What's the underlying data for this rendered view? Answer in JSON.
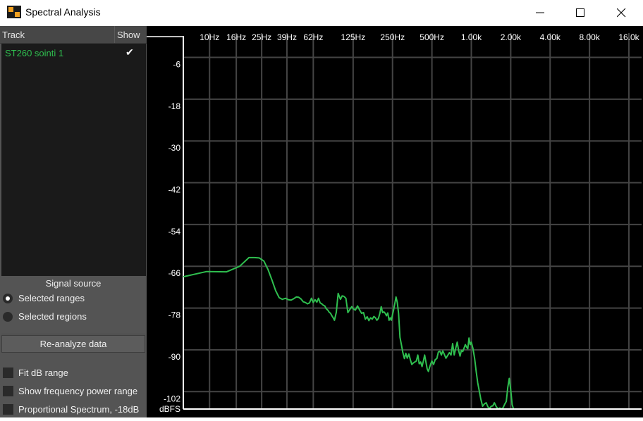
{
  "window": {
    "title": "Spectral Analysis",
    "icon": "spectral-app-icon",
    "buttons": [
      "minimize-icon",
      "maximize-icon",
      "close-icon"
    ]
  },
  "sidebar": {
    "track_header": "Track",
    "show_header": "Show",
    "tracks": [
      {
        "name": "ST260 sointi 1",
        "shown": true,
        "color": "#2fbf4f"
      }
    ],
    "signal_source": {
      "label": "Signal source",
      "options": [
        {
          "label": "Selected ranges",
          "selected": true
        },
        {
          "label": "Selected regions",
          "selected": false
        }
      ]
    },
    "reanalyze_label": "Re-analyze data",
    "checkboxes": [
      {
        "label": "Fit dB range",
        "checked": false
      },
      {
        "label": "Show frequency power range",
        "checked": false
      },
      {
        "label": "Proportional Spectrum, -18dB",
        "checked": false
      }
    ]
  },
  "plot": {
    "background": "#000000",
    "grid_color": "#444444",
    "axis_color": "#ffffff",
    "freq_labels": [
      "10Hz",
      "16Hz",
      "25Hz",
      "39Hz",
      "62Hz",
      "125Hz",
      "250Hz",
      "500Hz",
      "1.00k",
      "2.00k",
      "4.00k",
      "8.00k",
      "16.0k"
    ],
    "db_labels": [
      "-6",
      "-18",
      "-30",
      "-42",
      "-54",
      "-66",
      "-78",
      "-90",
      "-102"
    ],
    "db_unit": "dBFS"
  },
  "chart_data": {
    "type": "line",
    "title": "",
    "xlabel": "",
    "ylabel": "dBFS",
    "x_scale": "log",
    "xlim": [
      6.3,
      20000
    ],
    "ylim": [
      -107,
      3
    ],
    "grid": true,
    "x_ticks": [
      10,
      16,
      25,
      39,
      62,
      125,
      250,
      500,
      1000,
      2000,
      4000,
      8000,
      16000
    ],
    "y_ticks": [
      -6,
      -18,
      -30,
      -42,
      -54,
      -66,
      -78,
      -90,
      -102
    ],
    "series": [
      {
        "name": "ST260 sointi 1",
        "color": "#2fbf4f",
        "x": [
          6.3,
          9.5,
          13.5,
          17,
          20,
          22,
          24,
          26,
          28,
          30,
          32,
          34,
          36,
          38,
          40,
          42,
          44,
          46,
          48,
          50,
          52,
          54,
          56,
          58,
          60,
          62,
          64,
          66,
          68,
          70,
          72,
          74,
          76,
          78,
          80,
          82,
          84,
          86,
          88,
          90,
          93,
          96,
          100,
          103,
          106,
          110,
          114,
          118,
          122,
          126,
          130,
          135,
          140,
          145,
          150,
          155,
          160,
          165,
          170,
          175,
          180,
          185,
          190,
          195,
          200,
          205,
          210,
          215,
          220,
          225,
          230,
          235,
          240,
          245,
          250,
          255,
          260,
          266,
          272,
          278,
          285,
          292,
          300,
          308,
          316,
          324,
          333,
          342,
          351,
          360,
          370,
          380,
          390,
          400,
          410,
          420,
          430,
          440,
          450,
          460,
          470,
          480,
          490,
          500,
          515,
          530,
          545,
          560,
          575,
          590,
          605,
          620,
          640,
          660,
          680,
          700,
          720,
          740,
          760,
          780,
          800,
          820,
          840,
          860,
          880,
          900,
          920,
          940,
          960,
          980,
          1000,
          1030,
          1060,
          1090,
          1120,
          1150,
          1180,
          1220,
          1260,
          1300,
          1340,
          1380,
          1420,
          1460,
          1500,
          1550,
          1600,
          1650,
          1700,
          1750,
          1800,
          1850,
          1900,
          1950,
          2000,
          2050,
          2100,
          2150,
          2200,
          2300,
          2400,
          2500,
          2600,
          2700,
          2800,
          2900,
          3000
        ],
        "y": [
          -69,
          -67.5,
          -67.6,
          -66,
          -63.5,
          -63.5,
          -63.6,
          -64.5,
          -67,
          -70,
          -73,
          -75,
          -75.5,
          -75.2,
          -75.6,
          -75.7,
          -75.3,
          -74.8,
          -74.9,
          -75.4,
          -76.2,
          -76.4,
          -76.8,
          -76.5,
          -75.2,
          -76.4,
          -75.6,
          -76.3,
          -75.2,
          -76.5,
          -76.8,
          -77.2,
          -77.4,
          -78.2,
          -78.6,
          -79.2,
          -79.5,
          -80.2,
          -80.8,
          -81.5,
          -79.2,
          -73.8,
          -75.5,
          -74.5,
          -74.6,
          -75.2,
          -79.3,
          -78.4,
          -77.6,
          -78.3,
          -78.6,
          -77.4,
          -78.5,
          -79.5,
          -79.3,
          -81.2,
          -80.5,
          -81.6,
          -80.8,
          -81.2,
          -80.4,
          -80.8,
          -81.5,
          -81,
          -79.5,
          -77.6,
          -79.3,
          -79.1,
          -79.5,
          -80.2,
          -79.4,
          -81.5,
          -80.8,
          -81.5,
          -79.9,
          -78.5,
          -76.8,
          -74.8,
          -76.4,
          -79.5,
          -86.4,
          -88.5,
          -90.8,
          -92.5,
          -91,
          -92.4,
          -91.2,
          -92.8,
          -94.2,
          -93.8,
          -93.5,
          -93.2,
          -91.5,
          -94,
          -93.5,
          -94.8,
          -93.2,
          -91.5,
          -93.5,
          -95.5,
          -96.2,
          -95,
          -94,
          -93.2,
          -94.2,
          -92.8,
          -92.5,
          -90.6,
          -90.4,
          -91.5,
          -90.3,
          -91.2,
          -92.4,
          -91.6,
          -90.8,
          -91.5,
          -88.2,
          -91.5,
          -89.5,
          -87.8,
          -90.2,
          -91.8,
          -90.2,
          -90.5,
          -89.5,
          -88.5,
          -89.2,
          -89.7,
          -86.6,
          -88.5,
          -87.8,
          -89.7,
          -92.5,
          -96.2,
          -99.5,
          -101.8,
          -104,
          -106.2,
          -105.5,
          -105.2,
          -106.4,
          -106.8,
          -106.2,
          -106.1,
          -105.2,
          -106.3,
          -107,
          -106.7,
          -107,
          -106.6,
          -105.6,
          -104.8,
          -100.8,
          -98.2,
          -101.5,
          -105.7,
          -107,
          -107,
          -107,
          -107,
          -107,
          -107,
          -107,
          -107,
          -107,
          -107,
          -107
        ]
      }
    ]
  }
}
